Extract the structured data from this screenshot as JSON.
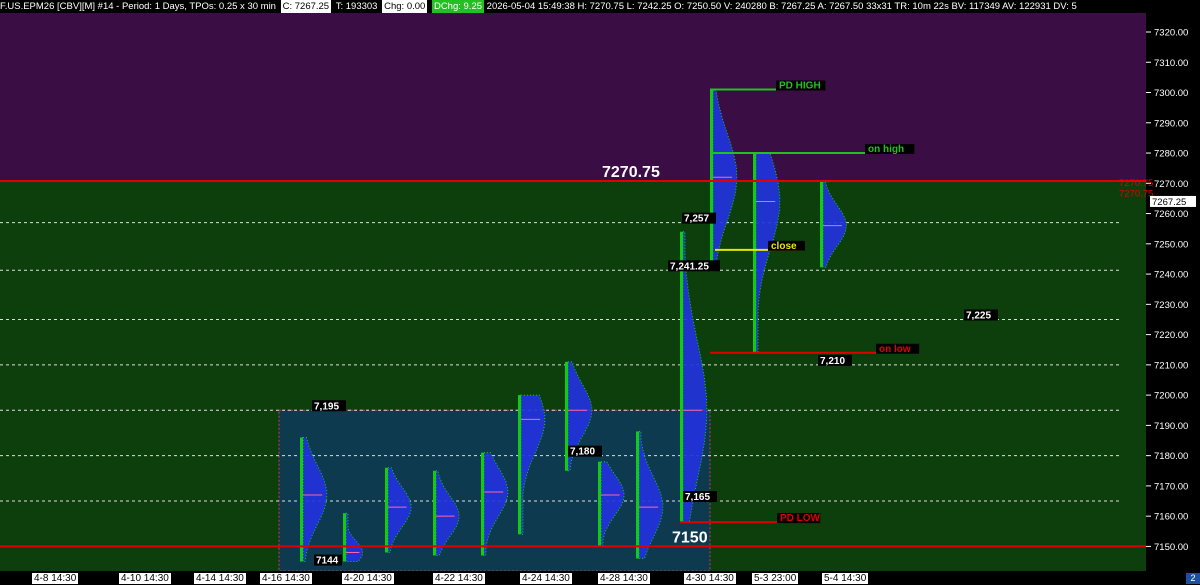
{
  "header": {
    "symbol": "F.US.EPM26 [CBV][M] #14 - Period: 1 Days, TPOs: 0.25 x 30 min",
    "close": "C: 7267.25",
    "trades": "T: 193303",
    "change": "Chg: 0.00",
    "dchange": "DChg: 9.25",
    "rest": "2026-05-04 15:49:38 H: 7270.75 L: 7242.25 O: 7250.50 V: 240280 B: 7267.25 A: 7267.50 33x31 TR: 10m 22s BV: 117349 AV: 122931 DV: 5"
  },
  "colors": {
    "upper_bg": "#3b0d45",
    "lower_bg": "#0d3f0d",
    "box_fill": "#0d3a4e",
    "red_line": "#e00000",
    "green_line": "#22c020",
    "yellow_line": "#e8e800",
    "tpo_blue": "#2233dd",
    "tpo_green": "#11cc11"
  },
  "chart_data": {
    "type": "market-profile",
    "ylim": [
      7145,
      7325
    ],
    "y_ticks": [
      7150,
      7160,
      7170,
      7180,
      7190,
      7200,
      7210,
      7220,
      7230,
      7240,
      7250,
      7260,
      7270,
      7280,
      7290,
      7300,
      7310,
      7320
    ],
    "y_tick_labels": [
      "7150.00",
      "7160.00",
      "7170.00",
      "7180.00",
      "7190.00",
      "7200.00",
      "7210.00",
      "7220.00",
      "7230.00",
      "7240.00",
      "7250.00",
      "7260.00",
      "7270.00",
      "7280.00",
      "7290.00",
      "7300.00",
      "7310.00",
      "7320.00"
    ],
    "price_tags": [
      {
        "text": "7270.75",
        "value": 7270.75,
        "style": "red"
      },
      {
        "text": "7270.75",
        "value": 7267.25,
        "style": "red"
      },
      {
        "text": "7267.25",
        "value": 7264.5,
        "style": "white"
      }
    ],
    "x_labels": [
      "4-8  14:30",
      "4-10  14:30",
      "4-14  14:30",
      "4-16  14:30",
      "4-20  14:30",
      "4-22  14:30",
      "4-24  14:30",
      "4-28  14:30",
      "4-30  14:30",
      "5-3  23:00",
      "5-4  14:30"
    ],
    "horizontal_levels": [
      {
        "value": 7270.75,
        "style": "red-full"
      },
      {
        "value": 7150,
        "style": "red-full"
      },
      {
        "value": 7257,
        "style": "dotted"
      },
      {
        "value": 7241.25,
        "style": "dotted"
      },
      {
        "value": 7225,
        "style": "dotted"
      },
      {
        "value": 7210,
        "style": "dotted"
      },
      {
        "value": 7195,
        "style": "dotted"
      },
      {
        "value": 7180,
        "style": "dotted"
      },
      {
        "value": 7165,
        "style": "dotted"
      }
    ],
    "value_box": {
      "top": 7195,
      "bottom": 7145
    },
    "level_labels": [
      {
        "text": "7270.75",
        "value": 7270.75,
        "style": "big"
      },
      {
        "text": "7150",
        "value": 7150,
        "style": "big"
      },
      {
        "text": "7,257",
        "value": 7257,
        "style": "small"
      },
      {
        "text": "7,241.25",
        "value": 7241.25,
        "style": "small"
      },
      {
        "text": "7,225",
        "value": 7225,
        "style": "small"
      },
      {
        "text": "7,210",
        "value": 7210,
        "style": "small"
      },
      {
        "text": "7,195",
        "value": 7195,
        "style": "small"
      },
      {
        "text": "7,180",
        "value": 7180,
        "style": "small"
      },
      {
        "text": "7,165",
        "value": 7165,
        "style": "small"
      },
      {
        "text": "7144",
        "value": 7144,
        "style": "small"
      }
    ],
    "annotations": [
      {
        "text": "PD HIGH",
        "value": 7301,
        "color": "#22c020"
      },
      {
        "text": "on high",
        "value": 7280,
        "color": "#22c020"
      },
      {
        "text": "close",
        "value": 7248,
        "color": "#e8e800"
      },
      {
        "text": "on low",
        "value": 7214,
        "color": "#e00000"
      },
      {
        "text": "PD LOW",
        "value": 7158,
        "color": "#e00000"
      }
    ],
    "profiles": [
      {
        "session": "4-16",
        "high": 7186,
        "low": 7145,
        "poc": 7167
      },
      {
        "session": "4-20",
        "high": 7161,
        "low": 7145,
        "poc": 7148
      },
      {
        "session": "4-22",
        "high": 7176,
        "low": 7148,
        "poc": 7163
      },
      {
        "session": "4-22b",
        "high": 7175,
        "low": 7147,
        "poc": 7160
      },
      {
        "session": "4-24",
        "high": 7181,
        "low": 7147,
        "poc": 7168
      },
      {
        "session": "4-24b",
        "high": 7200,
        "low": 7154,
        "poc": 7192
      },
      {
        "session": "4-24c",
        "high": 7211,
        "low": 7175,
        "poc": 7195
      },
      {
        "session": "4-28",
        "high": 7178,
        "low": 7150,
        "poc": 7167
      },
      {
        "session": "4-28b",
        "high": 7188,
        "low": 7146,
        "poc": 7163
      },
      {
        "session": "4-30",
        "high": 7254,
        "low": 7158,
        "poc": 7195
      },
      {
        "session": "5-1",
        "high": 7301,
        "low": 7241,
        "poc": 7272
      },
      {
        "session": "5-3",
        "high": 7280,
        "low": 7214,
        "poc": 7264
      },
      {
        "session": "5-4",
        "high": 7270.75,
        "low": 7242.25,
        "poc": 7256
      }
    ]
  }
}
